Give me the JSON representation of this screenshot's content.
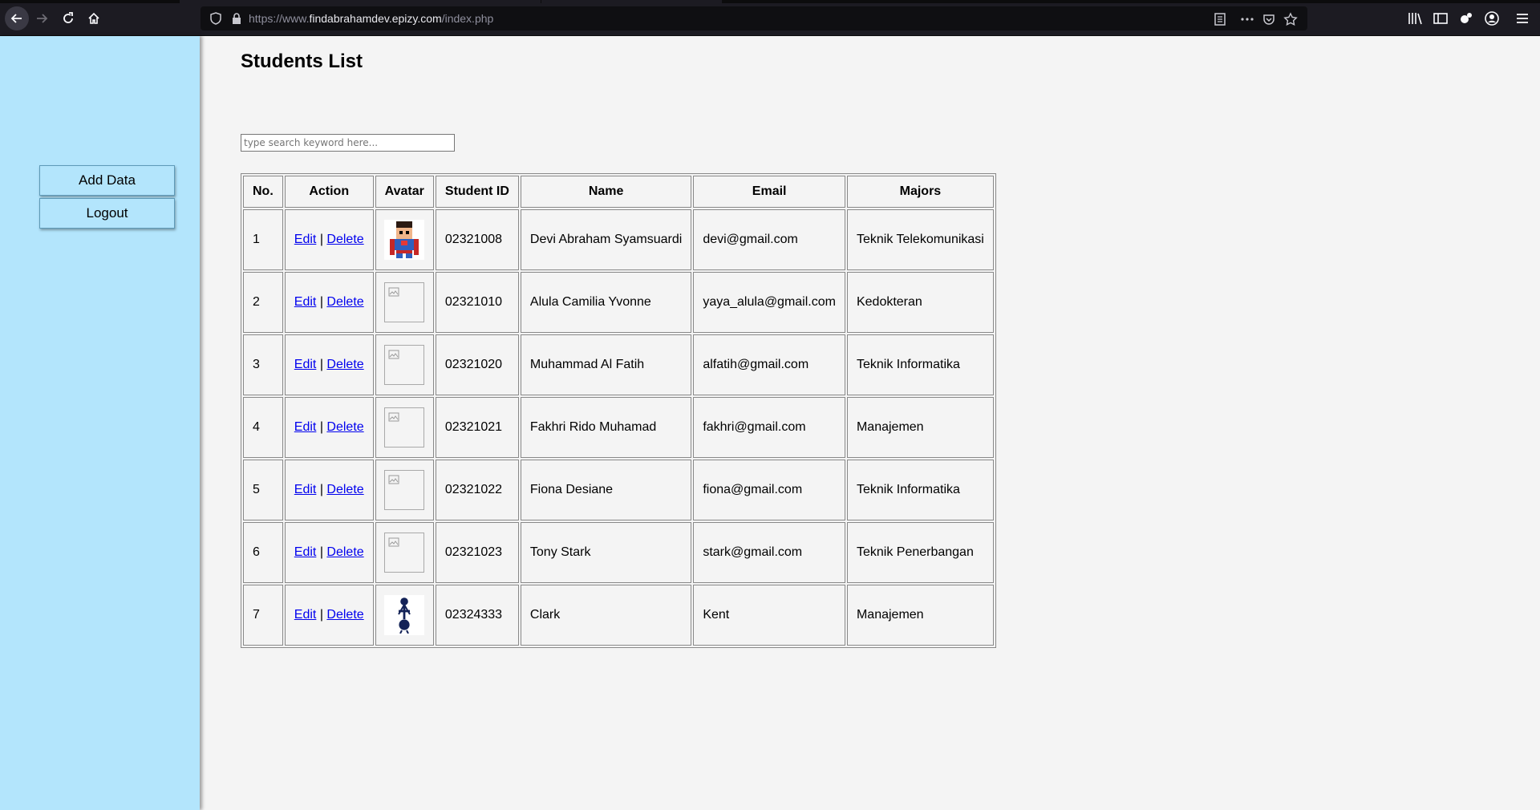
{
  "browser": {
    "url_prefix": "https://www.",
    "url_domain": "findabrahamdev.epizy.com",
    "url_path": "/index.php"
  },
  "sidebar": {
    "add_label": "Add Data",
    "logout_label": "Logout"
  },
  "main": {
    "title": "Students List",
    "search_placeholder": "type search keyword here...",
    "table": {
      "headers": [
        "No.",
        "Action",
        "Avatar",
        "Student ID",
        "Name",
        "Email",
        "Majors"
      ],
      "edit_label": "Edit",
      "separator": "|",
      "delete_label": "Delete",
      "rows": [
        {
          "no": "1",
          "avatar": "superman-pixel",
          "sid": "02321008",
          "name": "Devi Abraham Syamsuardi",
          "email": "devi@gmail.com",
          "major": "Teknik Telekomunikasi"
        },
        {
          "no": "2",
          "avatar": "broken-image",
          "sid": "02321010",
          "name": "Alula Camilia Yvonne",
          "email": "yaya_alula@gmail.com",
          "major": "Kedokteran"
        },
        {
          "no": "3",
          "avatar": "broken-image",
          "sid": "02321020",
          "name": "Muhammad Al Fatih",
          "email": "alfatih@gmail.com",
          "major": "Teknik Informatika"
        },
        {
          "no": "4",
          "avatar": "broken-image",
          "sid": "02321021",
          "name": "Fakhri Rido Muhamad",
          "email": "fakhri@gmail.com",
          "major": "Manajemen"
        },
        {
          "no": "5",
          "avatar": "broken-image",
          "sid": "02321022",
          "name": "Fiona Desiane",
          "email": "fiona@gmail.com",
          "major": "Teknik Informatika"
        },
        {
          "no": "6",
          "avatar": "broken-image",
          "sid": "02321023",
          "name": "Tony Stark",
          "email": "stark@gmail.com",
          "major": "Teknik Penerbangan"
        },
        {
          "no": "7",
          "avatar": "spurs-crest",
          "sid": "02324333",
          "name": "Clark",
          "email": "Kent",
          "major": "Manajemen"
        }
      ]
    }
  },
  "colors": {
    "sidebar_bg": "#b3e5fc",
    "page_bg": "#f4f4f4",
    "link": "#0000ee"
  }
}
